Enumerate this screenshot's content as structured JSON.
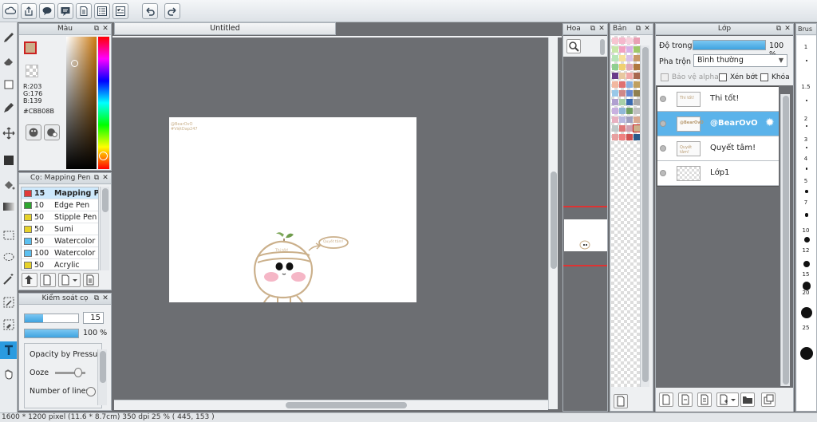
{
  "document": {
    "tab_title": "Untitled"
  },
  "color_panel": {
    "title": "Màu",
    "r": "R:203",
    "g": "G:176",
    "b": "B:139",
    "hex": "#CBB08B",
    "current_color": "#cbb08b"
  },
  "brush_panel": {
    "title": "Cọ: Mapping Pen",
    "items": [
      {
        "size": "15",
        "name": "Mapping Pen",
        "color": "#e03a3a"
      },
      {
        "size": "10",
        "name": "Edge Pen",
        "color": "#2ea62e"
      },
      {
        "size": "50",
        "name": "Stipple Pen",
        "color": "#e6d22a"
      },
      {
        "size": "50",
        "name": "Sumi",
        "color": "#e6d22a"
      },
      {
        "size": "50",
        "name": "Watercolor",
        "color": "#5bc0f0"
      },
      {
        "size": "100",
        "name": "Watercolor (W",
        "color": "#5bc0f0"
      },
      {
        "size": "50",
        "name": "Acrylic",
        "color": "#e6d22a"
      }
    ]
  },
  "brush_control": {
    "title": "Kiểm soát cọ",
    "size_value": "15",
    "opacity_value": "100 %",
    "size_fraction": 0.35,
    "opacity_fraction": 1.0,
    "opacity_by_pressure": "Opacity by Pressure",
    "ooze": "Ooze",
    "number_of_lines": "Number of lines"
  },
  "navigator": {
    "title": "Hoa"
  },
  "palette": {
    "title": "Bản"
  },
  "layer_panel": {
    "title": "Lớp",
    "opacity_label": "Độ trong",
    "opacity_value": "100 %",
    "blend_label": "Pha trộn",
    "blend_value": "Bình thường",
    "protect_alpha": "Bảo vệ alpha",
    "clipping": "Xén bớt",
    "lock": "Khóa",
    "layers": [
      {
        "name": "Thi tốt!",
        "thumb": "Thi tốt!",
        "selected": false
      },
      {
        "name": "@BearOvO",
        "thumb": "@BearOvO",
        "selected": true
      },
      {
        "name": "Quyết tâm!",
        "thumb": "Quyết tâm!",
        "selected": false
      },
      {
        "name": "Lớp1",
        "thumb": "",
        "selected": false
      }
    ]
  },
  "brush_size_panel": {
    "title": "Brus",
    "sizes": [
      "1",
      "1.5",
      "2",
      "3",
      "4",
      "5",
      "7",
      "10",
      "12",
      "15",
      "20",
      "25"
    ]
  },
  "canvas_art": {
    "watermark_line1": "@BearOvO",
    "watermark_line2": "#ViệtDap247",
    "headband": "Thi tốt!",
    "bubble": "Quyết tâm!"
  },
  "status": {
    "text": "1600 * 1200 pixel   (11.6 * 8.7cm)   350 dpi   25 %   ( 445, 153 )"
  }
}
